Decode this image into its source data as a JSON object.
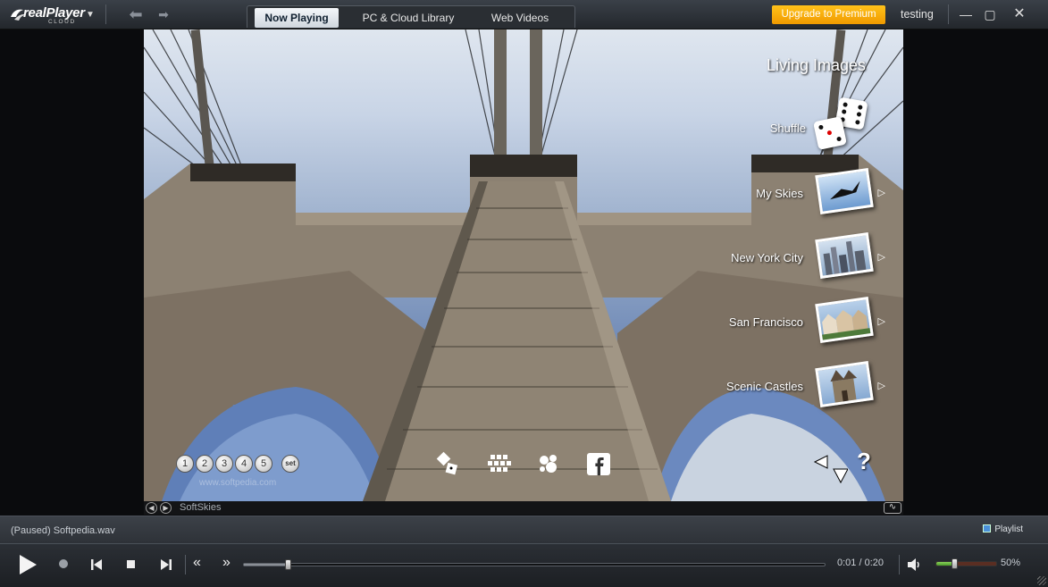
{
  "app": {
    "logo_main": "realPlayer",
    "logo_sub": "CLOUD",
    "tabs": [
      {
        "label": "Now Playing",
        "active": true
      },
      {
        "label": "PC & Cloud Library",
        "active": false
      },
      {
        "label": "Web Videos",
        "active": false
      }
    ],
    "premium_label": "Upgrade to Premium",
    "username": "testing",
    "accent_color": "#f5a800"
  },
  "viewer": {
    "menu_title": "Living Images",
    "shuffle_label": "Shuffle",
    "menu_items": [
      {
        "label": "My Skies",
        "icon": "bird-sky-thumbnail"
      },
      {
        "label": "New York City",
        "icon": "city-skyline-thumbnail"
      },
      {
        "label": "San Francisco",
        "icon": "victorian-houses-thumbnail"
      },
      {
        "label": "Scenic Castles",
        "icon": "castle-thumbnail"
      }
    ],
    "presets": [
      "1",
      "2",
      "3",
      "4",
      "5"
    ],
    "set_label": "set",
    "watermark": "www.softpedia.com",
    "help_glyph": "?"
  },
  "info_strip": {
    "title": "SoftSkies"
  },
  "status": {
    "text": "(Paused) Softpedia.wav",
    "playlist_label": "Playlist"
  },
  "transport": {
    "time": "0:01 / 0:20",
    "progress": 0.075,
    "volume_label": "50%",
    "volume": 0.3
  }
}
